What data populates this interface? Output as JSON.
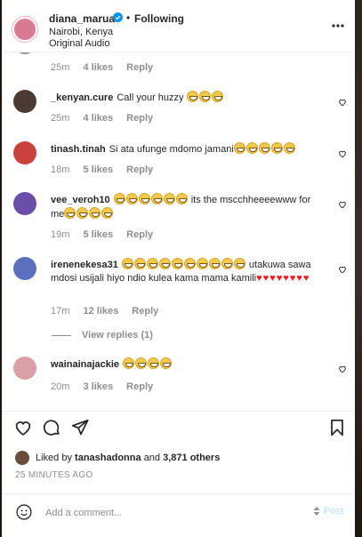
{
  "header": {
    "username": "diana_marua",
    "separator": "•",
    "follow_status": "Following",
    "location": "Nairobi, Kenya",
    "audio": "Original Audio",
    "more_icon": "more-horizontal-icon",
    "verified_icon": "verified-badge-icon"
  },
  "comments": {
    "top_partial": {
      "time": "25m",
      "likes": "4 likes",
      "reply": "Reply"
    },
    "items": [
      {
        "user": "_kenyan.cure",
        "text": "Call your huzzy",
        "emoji_count": 3,
        "hearts": 0,
        "extra_text": "",
        "time": "25m",
        "likes": "4 likes",
        "reply": "Reply",
        "avatar_color": "#4a3a32"
      },
      {
        "user": "tinash.tinah",
        "text": "Si ata ufunge mdomo jamani",
        "emoji_count": 5,
        "hearts": 0,
        "extra_text": "",
        "time": "18m",
        "likes": "5 likes",
        "reply": "Reply",
        "avatar_color": "#c8433e"
      },
      {
        "user": "vee_veroh10",
        "text": "",
        "emoji_count": 6,
        "hearts": 0,
        "extra_text": "its the mscchheeeewww for me",
        "extra_emoji_count": 4,
        "time": "19m",
        "likes": "5 likes",
        "reply": "Reply",
        "avatar_color": "#6a4ea8"
      },
      {
        "user": "irenenekesa31",
        "text": "",
        "emoji_count": 10,
        "hearts": 5,
        "extra_text": "utakuwa sawa mdosi usijali hiyo ndio kulea kama mama kamili",
        "extra_hearts": 3,
        "time": "17m",
        "likes": "12 likes",
        "reply": "Reply",
        "avatar_color": "#5b6fbf"
      },
      {
        "user": "wainainajackie",
        "text": "",
        "emoji_count": 4,
        "hearts": 0,
        "extra_text": "",
        "time": "20m",
        "likes": "3 likes",
        "reply": "Reply",
        "avatar_color": "#d9a0a6"
      }
    ],
    "view_replies": "View replies (1)"
  },
  "actions": {
    "like_icon": "heart-outline-icon",
    "comment_icon": "comment-icon",
    "share_icon": "share-icon",
    "save_icon": "bookmark-icon"
  },
  "liked_by": {
    "prefix": "Liked by",
    "user": "tanashadonna",
    "and": "and",
    "count": "3,871 others"
  },
  "timestamp": "25 MINUTES AGO",
  "add_comment": {
    "placeholder": "Add a comment...",
    "post_label": "Post",
    "emoji_icon": "smiley-icon"
  },
  "colors": {
    "accent_blue": "#0095f6",
    "post_disabled": "#b2dffc",
    "heart_red": "#ed1c24",
    "muted_text": "#8e8e8e"
  }
}
